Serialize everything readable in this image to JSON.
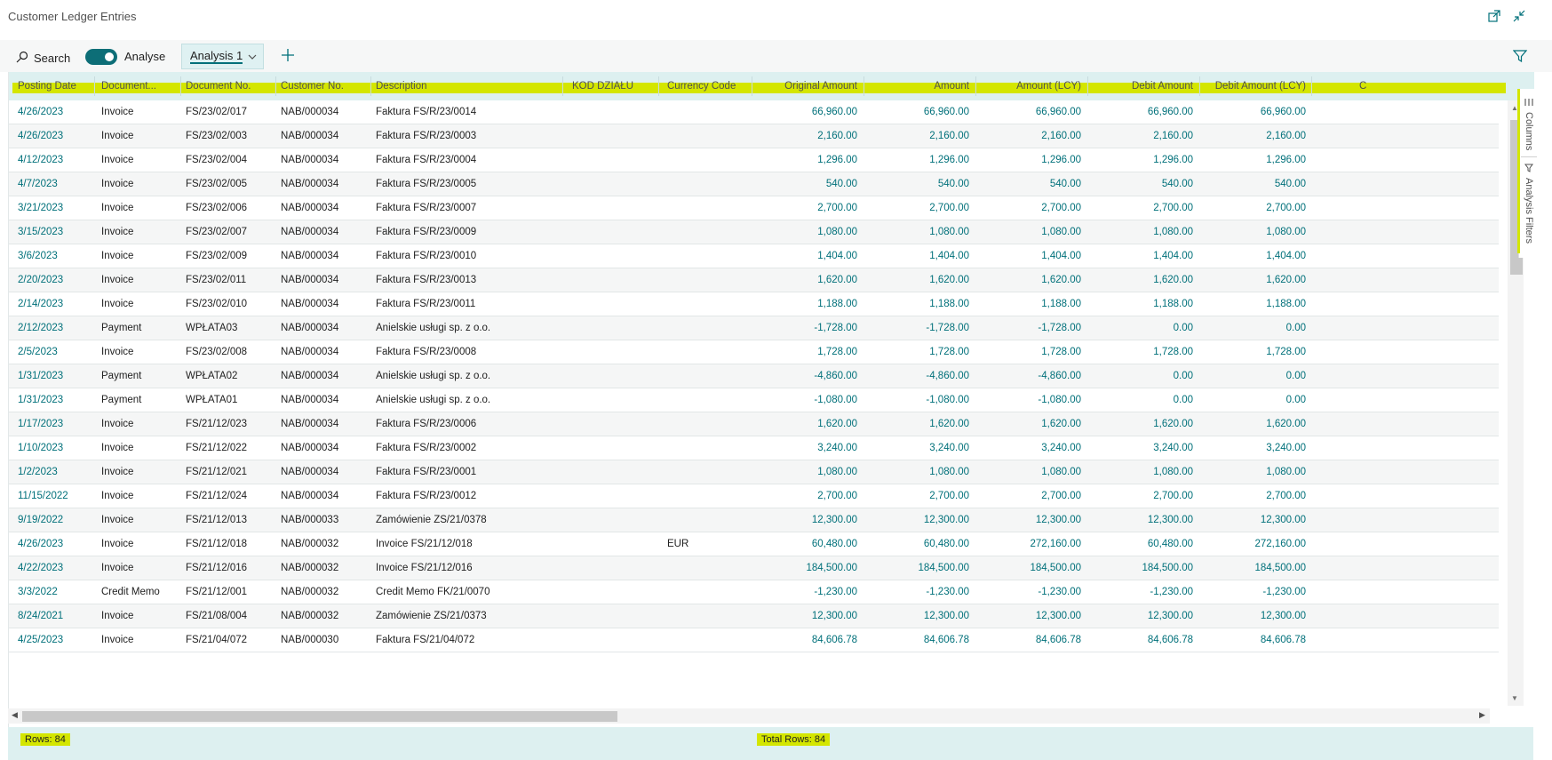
{
  "window": {
    "title": "Customer Ledger Entries",
    "icons": [
      "open-new-window-icon",
      "collapse-icon"
    ]
  },
  "toolbar": {
    "search_label": "Search",
    "analyse_label": "Analyse",
    "analyse_on": true,
    "tab_label": "Analysis 1",
    "add_tab_icon": "plus-icon",
    "filter_icon": "filter-icon"
  },
  "colors": {
    "accent": "#00707a",
    "header_bg": "#ddf0f0",
    "highlight": "#d4e600"
  },
  "columns": [
    "Posting Date",
    "Document...",
    "Document No.",
    "Customer No.",
    "Description",
    "KOD DZIAŁU",
    "Currency Code",
    "Original Amount",
    "Amount",
    "Amount (LCY)",
    "Debit Amount",
    "Debit Amount (LCY)",
    "C"
  ],
  "rows": [
    [
      "4/26/2023",
      "Invoice",
      "FS/23/02/017",
      "NAB/000034",
      "Faktura FS/R/23/0014",
      "",
      "",
      "66,960.00",
      "66,960.00",
      "66,960.00",
      "66,960.00",
      "66,960.00"
    ],
    [
      "4/26/2023",
      "Invoice",
      "FS/23/02/003",
      "NAB/000034",
      "Faktura FS/R/23/0003",
      "",
      "",
      "2,160.00",
      "2,160.00",
      "2,160.00",
      "2,160.00",
      "2,160.00"
    ],
    [
      "4/12/2023",
      "Invoice",
      "FS/23/02/004",
      "NAB/000034",
      "Faktura FS/R/23/0004",
      "",
      "",
      "1,296.00",
      "1,296.00",
      "1,296.00",
      "1,296.00",
      "1,296.00"
    ],
    [
      "4/7/2023",
      "Invoice",
      "FS/23/02/005",
      "NAB/000034",
      "Faktura FS/R/23/0005",
      "",
      "",
      "540.00",
      "540.00",
      "540.00",
      "540.00",
      "540.00"
    ],
    [
      "3/21/2023",
      "Invoice",
      "FS/23/02/006",
      "NAB/000034",
      "Faktura FS/R/23/0007",
      "",
      "",
      "2,700.00",
      "2,700.00",
      "2,700.00",
      "2,700.00",
      "2,700.00"
    ],
    [
      "3/15/2023",
      "Invoice",
      "FS/23/02/007",
      "NAB/000034",
      "Faktura FS/R/23/0009",
      "",
      "",
      "1,080.00",
      "1,080.00",
      "1,080.00",
      "1,080.00",
      "1,080.00"
    ],
    [
      "3/6/2023",
      "Invoice",
      "FS/23/02/009",
      "NAB/000034",
      "Faktura FS/R/23/0010",
      "",
      "",
      "1,404.00",
      "1,404.00",
      "1,404.00",
      "1,404.00",
      "1,404.00"
    ],
    [
      "2/20/2023",
      "Invoice",
      "FS/23/02/011",
      "NAB/000034",
      "Faktura FS/R/23/0013",
      "",
      "",
      "1,620.00",
      "1,620.00",
      "1,620.00",
      "1,620.00",
      "1,620.00"
    ],
    [
      "2/14/2023",
      "Invoice",
      "FS/23/02/010",
      "NAB/000034",
      "Faktura FS/R/23/0011",
      "",
      "",
      "1,188.00",
      "1,188.00",
      "1,188.00",
      "1,188.00",
      "1,188.00"
    ],
    [
      "2/12/2023",
      "Payment",
      "WPŁATA03",
      "NAB/000034",
      "Anielskie usługi sp. z o.o.",
      "",
      "",
      "-1,728.00",
      "-1,728.00",
      "-1,728.00",
      "0.00",
      "0.00"
    ],
    [
      "2/5/2023",
      "Invoice",
      "FS/23/02/008",
      "NAB/000034",
      "Faktura FS/R/23/0008",
      "",
      "",
      "1,728.00",
      "1,728.00",
      "1,728.00",
      "1,728.00",
      "1,728.00"
    ],
    [
      "1/31/2023",
      "Payment",
      "WPŁATA02",
      "NAB/000034",
      "Anielskie usługi sp. z o.o.",
      "",
      "",
      "-4,860.00",
      "-4,860.00",
      "-4,860.00",
      "0.00",
      "0.00"
    ],
    [
      "1/31/2023",
      "Payment",
      "WPŁATA01",
      "NAB/000034",
      "Anielskie usługi sp. z o.o.",
      "",
      "",
      "-1,080.00",
      "-1,080.00",
      "-1,080.00",
      "0.00",
      "0.00"
    ],
    [
      "1/17/2023",
      "Invoice",
      "FS/21/12/023",
      "NAB/000034",
      "Faktura FS/R/23/0006",
      "",
      "",
      "1,620.00",
      "1,620.00",
      "1,620.00",
      "1,620.00",
      "1,620.00"
    ],
    [
      "1/10/2023",
      "Invoice",
      "FS/21/12/022",
      "NAB/000034",
      "Faktura FS/R/23/0002",
      "",
      "",
      "3,240.00",
      "3,240.00",
      "3,240.00",
      "3,240.00",
      "3,240.00"
    ],
    [
      "1/2/2023",
      "Invoice",
      "FS/21/12/021",
      "NAB/000034",
      "Faktura FS/R/23/0001",
      "",
      "",
      "1,080.00",
      "1,080.00",
      "1,080.00",
      "1,080.00",
      "1,080.00"
    ],
    [
      "11/15/2022",
      "Invoice",
      "FS/21/12/024",
      "NAB/000034",
      "Faktura FS/R/23/0012",
      "",
      "",
      "2,700.00",
      "2,700.00",
      "2,700.00",
      "2,700.00",
      "2,700.00"
    ],
    [
      "9/19/2022",
      "Invoice",
      "FS/21/12/013",
      "NAB/000033",
      "Zamówienie ZS/21/0378",
      "",
      "",
      "12,300.00",
      "12,300.00",
      "12,300.00",
      "12,300.00",
      "12,300.00"
    ],
    [
      "4/26/2023",
      "Invoice",
      "FS/21/12/018",
      "NAB/000032",
      "Invoice FS/21/12/018",
      "",
      "EUR",
      "60,480.00",
      "60,480.00",
      "272,160.00",
      "60,480.00",
      "272,160.00"
    ],
    [
      "4/22/2023",
      "Invoice",
      "FS/21/12/016",
      "NAB/000032",
      "Invoice FS/21/12/016",
      "",
      "",
      "184,500.00",
      "184,500.00",
      "184,500.00",
      "184,500.00",
      "184,500.00"
    ],
    [
      "3/3/2022",
      "Credit Memo",
      "FS/21/12/001",
      "NAB/000032",
      "Credit Memo FK/21/0070",
      "",
      "",
      "-1,230.00",
      "-1,230.00",
      "-1,230.00",
      "-1,230.00",
      "-1,230.00"
    ],
    [
      "8/24/2021",
      "Invoice",
      "FS/21/08/004",
      "NAB/000032",
      "Zamówienie ZS/21/0373",
      "",
      "",
      "12,300.00",
      "12,300.00",
      "12,300.00",
      "12,300.00",
      "12,300.00"
    ],
    [
      "4/25/2023",
      "Invoice",
      "FS/21/04/072",
      "NAB/000030",
      "Faktura FS/21/04/072",
      "",
      "",
      "84,606.78",
      "84,606.78",
      "84,606.78",
      "84,606.78",
      "84,606.78"
    ]
  ],
  "side_panel": {
    "columns_label": "Columns",
    "filters_label": "Analysis Filters"
  },
  "footer": {
    "rows_label": "Rows: 84",
    "total_rows_label": "Total Rows: 84"
  }
}
